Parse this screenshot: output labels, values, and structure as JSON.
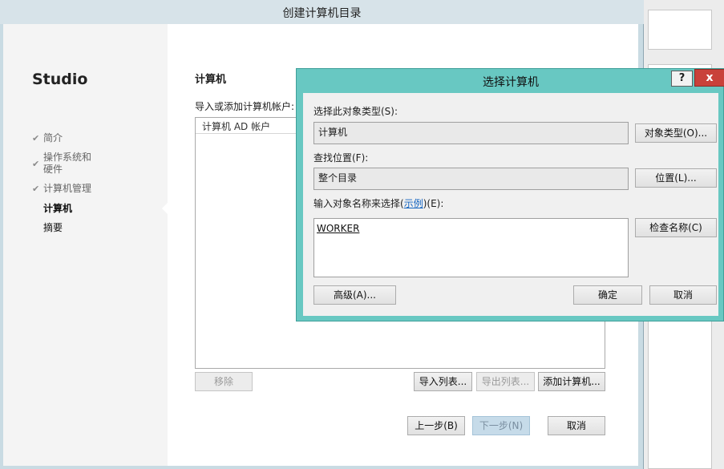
{
  "wizard": {
    "title": "创建计算机目录",
    "brand": "Studio",
    "nav_items": [
      {
        "label": "简介",
        "done": true
      },
      {
        "label": "操作系统和\n硬件",
        "done": true
      },
      {
        "label": "计算机管理",
        "done": true
      },
      {
        "label": "计算机",
        "current": true
      },
      {
        "label": "摘要"
      }
    ],
    "content_title": "计算机",
    "import_label": "导入或添加计算机帐户:",
    "column_header": "计算机 AD 帐户",
    "buttons": {
      "remove": "移除",
      "import_list": "导入列表...",
      "export_list": "导出列表...",
      "add_computers": "添加计算机...",
      "back": "上一步(B)",
      "next": "下一步(N)",
      "cancel": "取消"
    }
  },
  "dialog": {
    "title": "选择计算机",
    "help": "?",
    "close": "x",
    "object_type_label": "选择此对象类型(S):",
    "object_type_value": "计算机",
    "object_type_button": "对象类型(O)...",
    "location_label": "查找位置(F):",
    "location_value": "整个目录",
    "location_button": "位置(L)...",
    "names_label_pre": "输入对象名称来选择(",
    "names_label_link": "示例",
    "names_label_post": ")(E):",
    "names_value": "WORKER",
    "check_names_button": "检查名称(C)",
    "advanced_button": "高级(A)...",
    "ok_button": "确定",
    "cancel_button": "取消"
  },
  "colors": {
    "dialog_frame": "#68c8c2",
    "close_button": "#c9413a",
    "link": "#1565c0"
  }
}
